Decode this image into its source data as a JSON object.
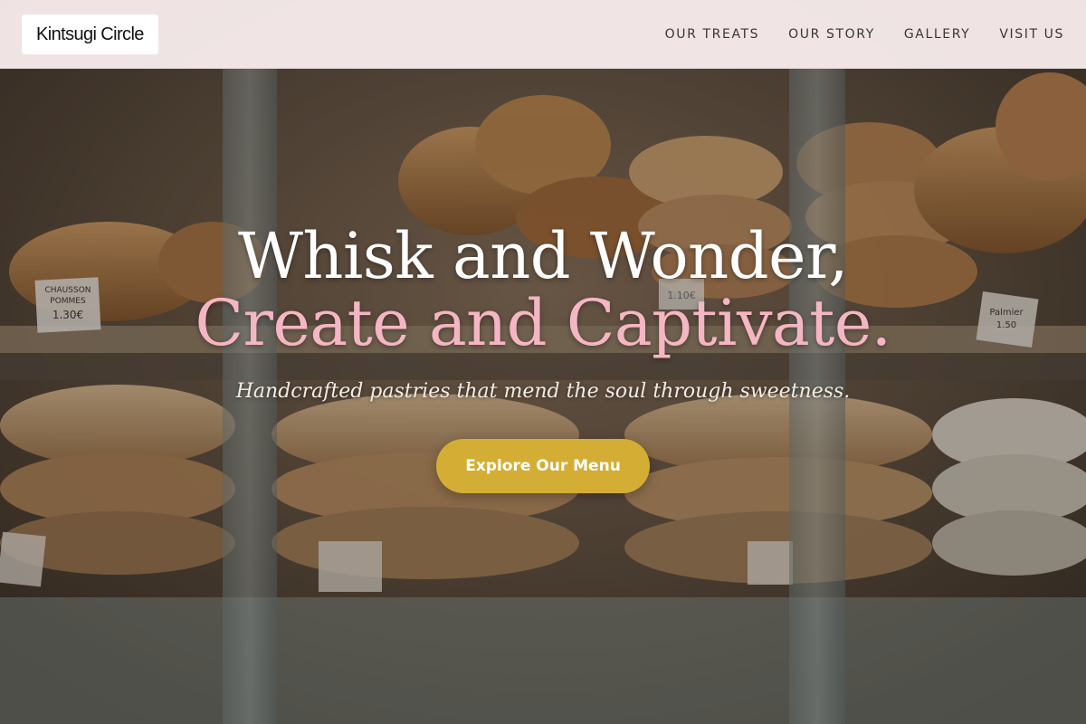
{
  "header": {
    "logo": "Kintsugi Circle",
    "nav": [
      {
        "label": "OUR TREATS"
      },
      {
        "label": "OUR STORY"
      },
      {
        "label": "GALLERY"
      },
      {
        "label": "VISIT US"
      }
    ]
  },
  "hero": {
    "headline_line1": "Whisk and Wonder,",
    "headline_line2": "Create and Captivate.",
    "tagline": "Handcrafted pastries that mend the soul through sweetness.",
    "cta_label": "Explore Our Menu",
    "background_image": "bakery pastry display case with croissants and pies",
    "price_tags": [
      "CHAUSSON",
      "POMMES",
      "1.30€",
      "1.10€",
      "Palmier",
      "1.50"
    ]
  },
  "colors": {
    "header_bg": "#fdf1f2",
    "headline_white": "#ffffff",
    "headline_pink": "#f5b6c3",
    "cta_gold": "#d4ae34"
  }
}
